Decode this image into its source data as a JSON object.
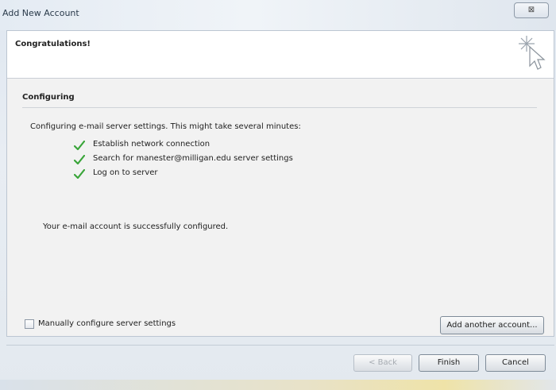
{
  "window": {
    "title": "Add New Account",
    "close_label": "⊠"
  },
  "header": {
    "title": "Congratulations!",
    "icon": "sparkle-cursor-icon"
  },
  "section": {
    "title": "Configuring"
  },
  "status": {
    "intro": "Configuring e-mail server settings. This might take several minutes:",
    "steps": [
      {
        "label": "Establish network connection",
        "icon": "green-check-icon"
      },
      {
        "label": "Search for manester@milligan.edu server settings",
        "icon": "green-check-icon"
      },
      {
        "label": "Log on to server",
        "icon": "green-check-icon"
      }
    ],
    "success": "Your e-mail account is successfully configured."
  },
  "options": {
    "manual_label": "Manually configure server settings",
    "manual_checked": false
  },
  "buttons": {
    "add_another": "Add another account...",
    "back": "< Back",
    "finish": "Finish",
    "cancel": "Cancel"
  },
  "colors": {
    "check": "#3aa53a",
    "header_bg": "#ffffff",
    "panel_bg": "#f2f2f2"
  }
}
